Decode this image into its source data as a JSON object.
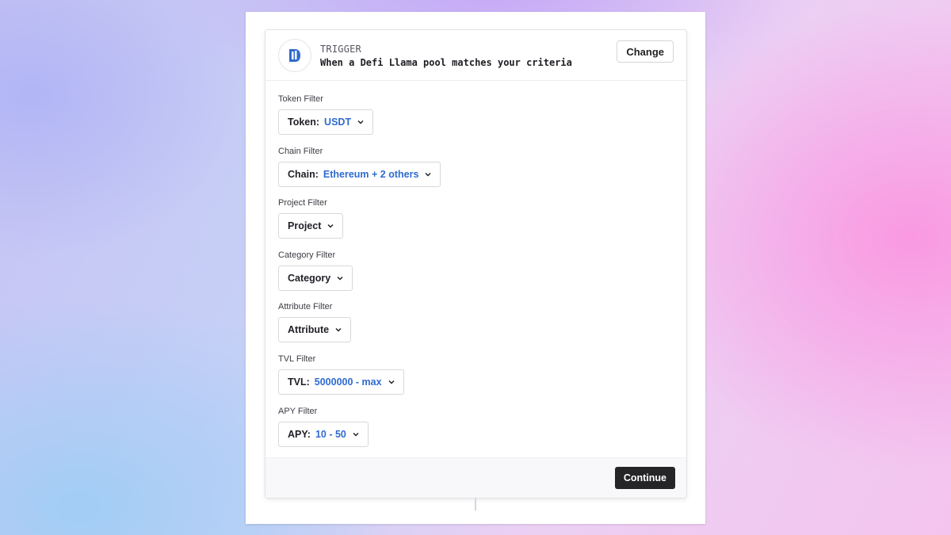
{
  "trigger": {
    "label": "TRIGGER",
    "description": "When a Defi Llama pool matches your criteria",
    "change_label": "Change",
    "app_icon": "defillama-logo-icon",
    "accent_color": "#2f6bd0"
  },
  "filters": [
    {
      "label": "Token Filter",
      "key": "Token:",
      "value": "USDT"
    },
    {
      "label": "Chain Filter",
      "key": "Chain:",
      "value": "Ethereum + 2 others"
    },
    {
      "label": "Project Filter",
      "key": "Project",
      "value": ""
    },
    {
      "label": "Category Filter",
      "key": "Category",
      "value": ""
    },
    {
      "label": "Attribute Filter",
      "key": "Attribute",
      "value": ""
    },
    {
      "label": "TVL Filter",
      "key": "TVL:",
      "value": "5000000 - max"
    },
    {
      "label": "APY Filter",
      "key": "APY:",
      "value": "10 - 50"
    }
  ],
  "footer": {
    "continue_label": "Continue"
  }
}
